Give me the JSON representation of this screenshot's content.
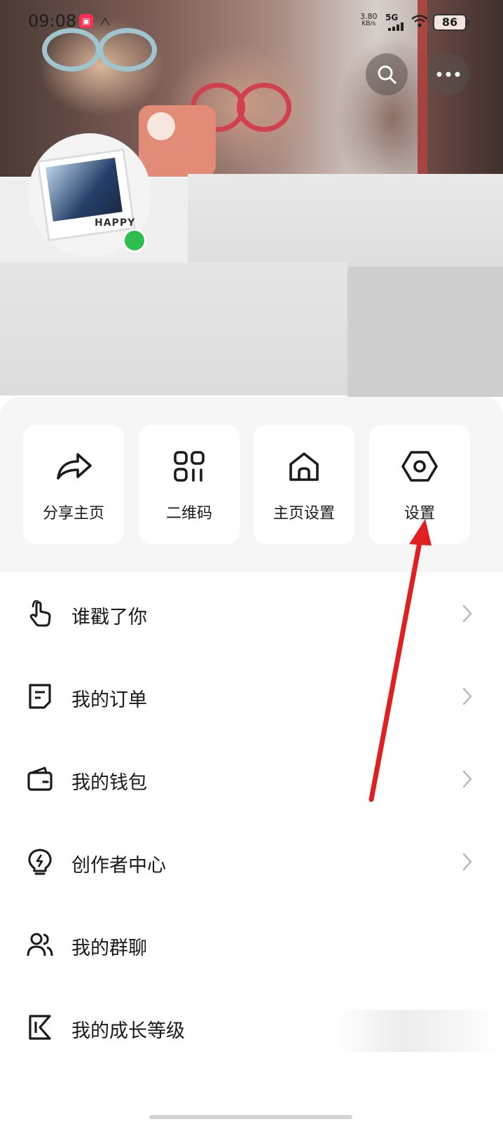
{
  "status_bar": {
    "time": "09:08",
    "net_speed_value": "3.80",
    "net_speed_unit": "KB/s",
    "network": "5G",
    "battery": "86"
  },
  "header": {
    "search_icon": "search-icon",
    "more_icon": "more-horizontal-icon",
    "avatar_text": "HAPPY"
  },
  "quick_actions": [
    {
      "label": "分享主页",
      "icon": "share-arrow-icon"
    },
    {
      "label": "二维码",
      "icon": "qr-code-icon"
    },
    {
      "label": "主页设置",
      "icon": "home-icon"
    },
    {
      "label": "设置",
      "icon": "settings-hexagon-icon"
    }
  ],
  "menu": [
    {
      "label": "谁戳了你",
      "icon": "tap-hand-icon",
      "chevron": true
    },
    {
      "label": "我的订单",
      "icon": "order-document-icon",
      "chevron": true
    },
    {
      "label": "我的钱包",
      "icon": "wallet-icon",
      "chevron": true
    },
    {
      "label": "创作者中心",
      "icon": "lightbulb-icon",
      "chevron": true
    },
    {
      "label": "我的群聊",
      "icon": "group-users-icon",
      "chevron": false
    },
    {
      "label": "我的成长等级",
      "icon": "k-level-icon",
      "chevron": false
    }
  ],
  "colors": {
    "annotation_arrow": "#e02020",
    "online_status": "#2ebd4f",
    "sheet_background": "#f6f6f6"
  }
}
